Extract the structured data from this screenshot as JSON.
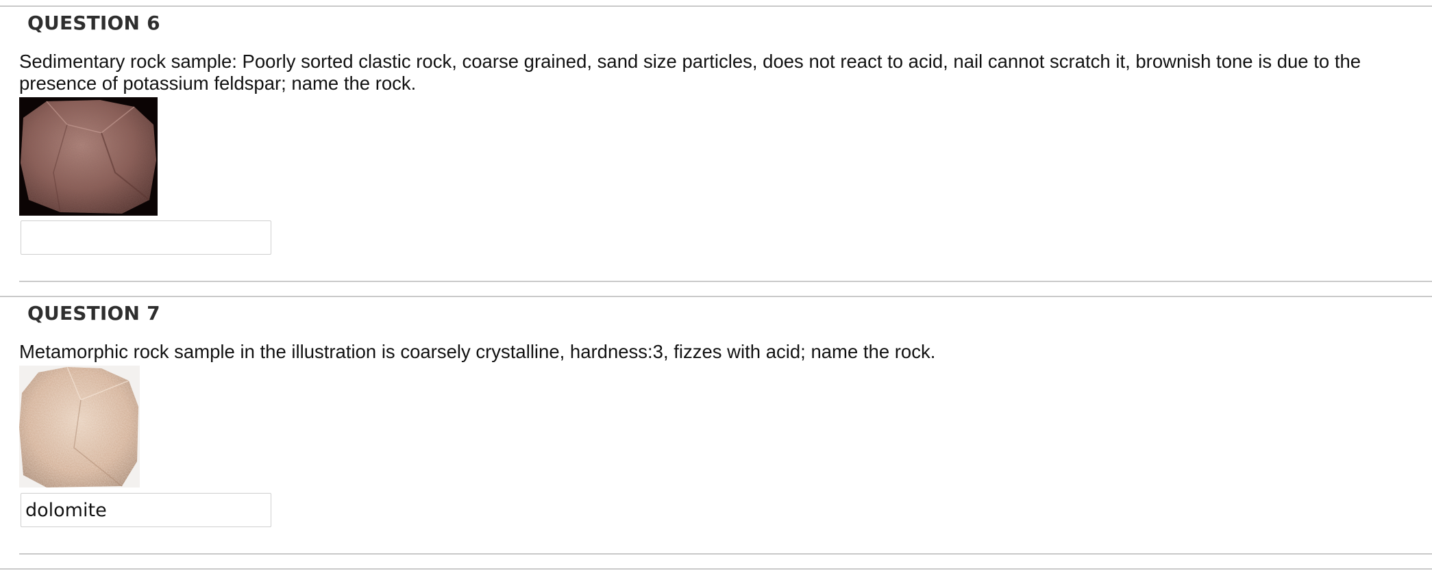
{
  "questions": [
    {
      "title": "QUESTION 6",
      "text": "Sedimentary rock sample: Poorly sorted clastic rock, coarse grained, sand size particles, does not react to acid, nail cannot scratch it, brownish tone is due to the presence of potassium feldspar; name the rock.",
      "answer_value": ""
    },
    {
      "title": "QUESTION 7",
      "text": "Metamorphic rock sample in the illustration is coarsely crystalline, hardness:3, fizzes with acid; name the rock.",
      "answer_value": "dolomite"
    }
  ]
}
